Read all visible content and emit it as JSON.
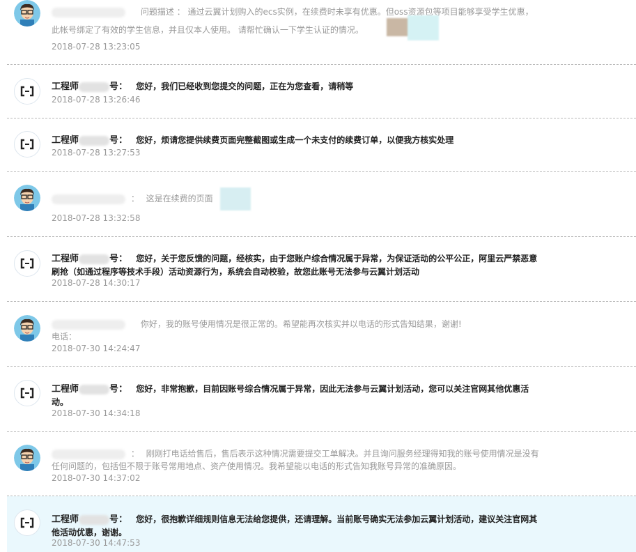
{
  "messages": [
    {
      "role": "user",
      "prefix": "问题描述 ：",
      "text": "通过云翼计划购入的ecs实例，在续费时未享有优惠。但oss资源包等项目能够享受学生优惠，此帐号绑定了有效的学生信息，并且仅本人使用。 请帮忙确认一下学生认证的情况。",
      "time": "2018-07-28 13:23:05"
    },
    {
      "role": "staff",
      "name": "工程师",
      "suffix": "号：",
      "text": "您好，我们已经收到您提交的问题，正在为您查看，请稍等",
      "time": "2018-07-28 13:26:46"
    },
    {
      "role": "staff",
      "name": "工程师",
      "suffix": "号：",
      "text": "您好，烦请您提供续费页面完整截图或生成一个未支付的续费订单，以便我方核实处理",
      "time": "2018-07-28 13:27:53"
    },
    {
      "role": "user",
      "prefix": "：",
      "text": "这是在续费的页面",
      "time": "2018-07-28 13:32:58"
    },
    {
      "role": "staff",
      "name": "工程师",
      "suffix": "号：",
      "text": "您好，关于您反馈的问题，经核实，由于您账户综合情况属于异常，为保证活动的公平公正，阿里云严禁恶意刷抢（如通过程序等技术手段）活动资源行为，系统会自动校验，故您此账号无法参与云翼计划活动",
      "time": "2018-07-28 14:30:17"
    },
    {
      "role": "user",
      "prefix": "",
      "text": "你好，我的账号使用情况是很正常的。希望能再次核实并以电话的形式告知结果，谢谢!",
      "extra": "电话：",
      "time": "2018-07-30 14:24:47"
    },
    {
      "role": "staff",
      "name": "工程师",
      "suffix": "号：",
      "text": "您好，非常抱歉，目前因账号综合情况属于异常，因此无法参与云翼计划活动，您可以关注官网其他优惠活动。",
      "time": "2018-07-30 14:34:18"
    },
    {
      "role": "user",
      "prefix": "：",
      "text": "刚刚打电话给售后，售后表示这种情况需要提交工单解决。并且询问服务经理得知我的账号使用情况是没有任何问题的，包括但不限于账号常用地点、资产使用情况。我希望能以电话的形式告知我账号异常的准确原因。",
      "time": "2018-07-30 14:37:02"
    },
    {
      "role": "staff",
      "name": "工程师",
      "suffix": "号：",
      "text": "您好，很抱歉详细规则信息无法给您提供，还请理解。当前账号确实无法参加云翼计划活动，建议关注官网其他活动优惠，谢谢。",
      "time": "2018-07-30 14:47:53"
    }
  ]
}
